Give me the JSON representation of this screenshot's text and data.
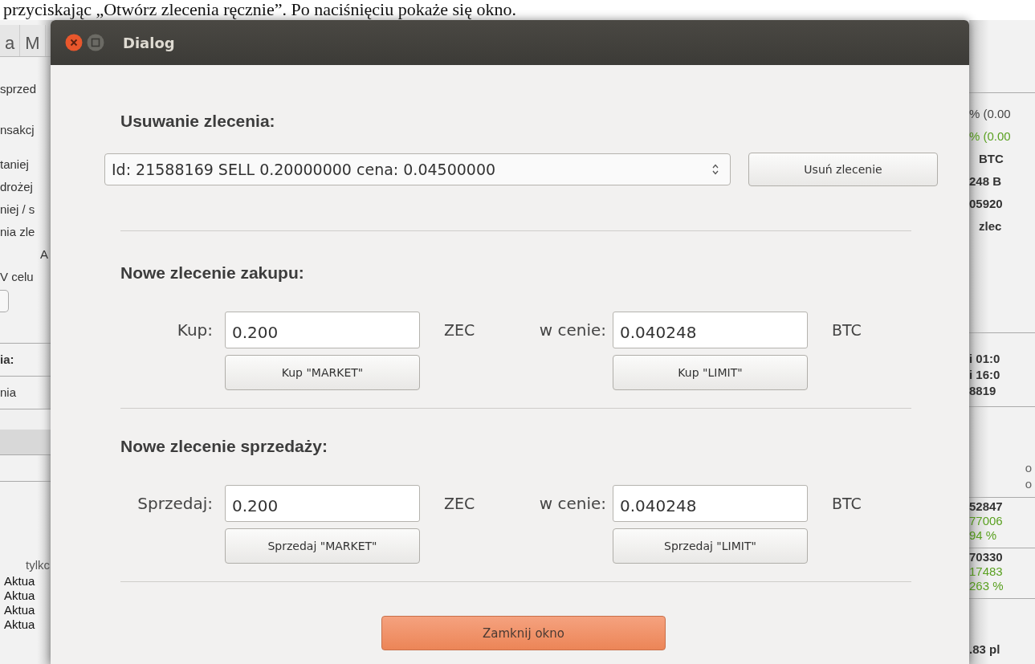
{
  "document_text": "przyciskając „Otwórz zlecenia ręcznie”. Po naciśnięciu pokaże się okno.",
  "background_window": {
    "tabs": [
      {
        "label": "a",
        "selected": false
      },
      {
        "label": "M",
        "selected": false
      }
    ],
    "left_lines": [
      "sprzed",
      "nsakcj",
      "taniej",
      "drożej",
      "niej / s",
      "nia zle",
      "A",
      "V celu"
    ],
    "left_field_label": "ia:",
    "left_field_value": "nia",
    "left_table_header": "tylkc",
    "left_log_rows": [
      "Aktua",
      "Aktua",
      "Aktua",
      "Aktua"
    ],
    "right_stats": [
      {
        "text": "% (0.00",
        "kind": "plain"
      },
      {
        "text": "% (0.00",
        "kind": "green"
      },
      {
        "text": "BTC",
        "kind": "bold"
      },
      {
        "text": "248 B",
        "kind": "bold"
      },
      {
        "text": "05920",
        "kind": "bold"
      },
      {
        "text": "zlec",
        "kind": "bold"
      }
    ],
    "right_times": [
      "i 01:0",
      "i 16:0",
      "8819"
    ],
    "right_headers": [
      "o",
      "o"
    ],
    "right_values": [
      [
        {
          "text": "52847",
          "kind": "bold"
        },
        {
          "text": "77006",
          "kind": "green"
        },
        {
          "text": "94 %",
          "kind": "green"
        }
      ],
      [
        {
          "text": "70330",
          "kind": "bold"
        },
        {
          "text": "17483",
          "kind": "green"
        },
        {
          "text": "263 %",
          "kind": "green"
        }
      ]
    ],
    "right_footer": ".83 pl"
  },
  "dialog": {
    "title": "Dialog",
    "delete_section": {
      "heading": "Usuwanie zlecenia:",
      "order_select": "Id: 21588169 SELL 0.20000000 cena: 0.04500000",
      "button": "Usuń zlecenie"
    },
    "buy_section": {
      "heading": "Nowe zlecenie zakupu:",
      "amount_label": "Kup:",
      "amount": "0.200",
      "amount_unit": "ZEC",
      "price_label": "w cenie:",
      "price": "0.040248",
      "price_unit": "BTC",
      "market_button": "Kup \"MARKET\"",
      "limit_button": "Kup \"LIMIT\""
    },
    "sell_section": {
      "heading": "Nowe zlecenie sprzedaży:",
      "amount_label": "Sprzedaj:",
      "amount": "0.200",
      "amount_unit": "ZEC",
      "price_label": "w cenie:",
      "price": "0.040248",
      "price_unit": "BTC",
      "market_button": "Sprzedaj \"MARKET\"",
      "limit_button": "Sprzedaj \"LIMIT\""
    },
    "close_button": "Zamknij okno"
  }
}
